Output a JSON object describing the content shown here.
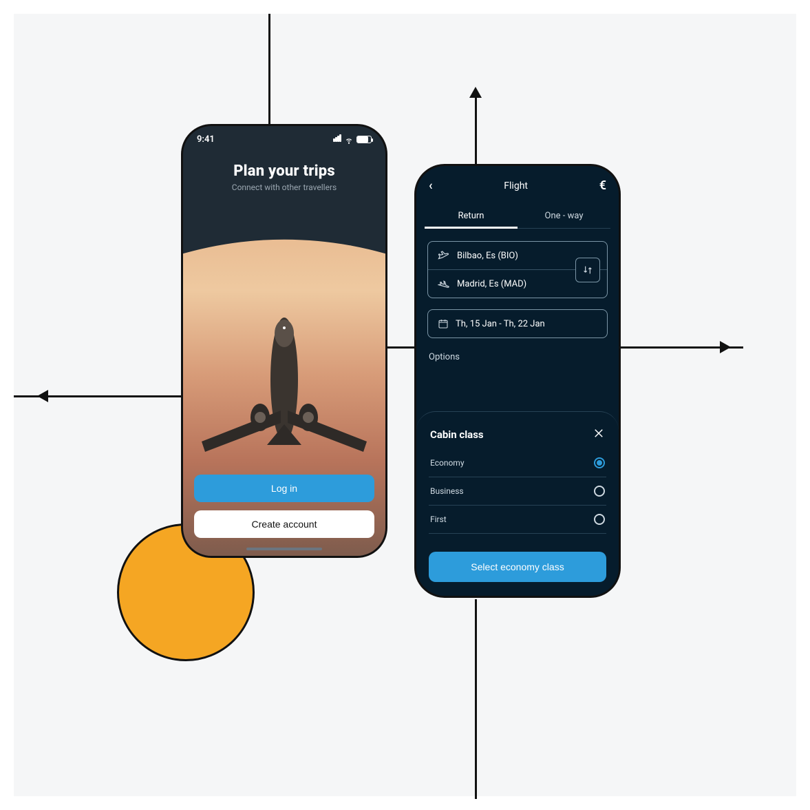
{
  "colors": {
    "accent": "#2d9cdb",
    "orange": "#f5a623",
    "dark1": "#1f2b35",
    "dark2": "#061c2c"
  },
  "statusbar": {
    "time": "9:41"
  },
  "welcome": {
    "title": "Plan your trips",
    "subtitle": "Connect with other travellers",
    "login": "Log in",
    "create": "Create account"
  },
  "flight": {
    "back": "‹",
    "title": "Flight",
    "currency": "€",
    "tabs": {
      "return": "Return",
      "oneway": "One - way",
      "active": "return"
    },
    "from": "Bilbao, Es (BIO)",
    "to": "Madrid, Es (MAD)",
    "dates": "Th, 15 Jan - Th, 22 Jan",
    "options_label": "Options",
    "sheet": {
      "title": "Cabin class",
      "items": [
        {
          "label": "Economy",
          "selected": true
        },
        {
          "label": "Business",
          "selected": false
        },
        {
          "label": "First",
          "selected": false
        }
      ],
      "cta": "Select economy class"
    }
  }
}
